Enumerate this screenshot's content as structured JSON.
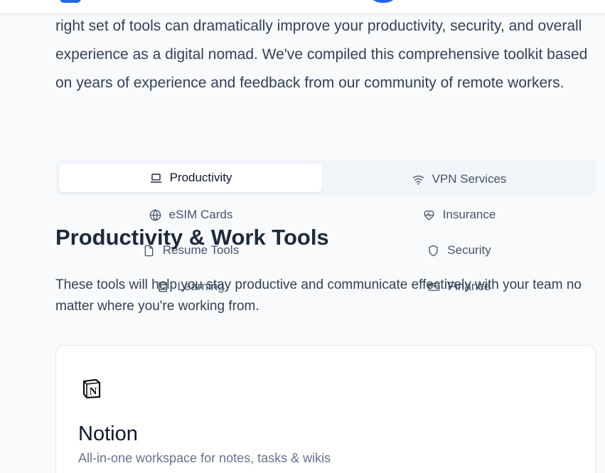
{
  "intro": {
    "text": "right set of tools can dramatically improve your productivity, security, and overall experience as a digital nomad. We've compiled this comprehensive toolkit based on years of experience and feedback from our community of remote workers."
  },
  "tabs": [
    {
      "label": "Productivity",
      "icon": "laptop-icon",
      "active": true
    },
    {
      "label": "VPN Services",
      "icon": "wifi-icon",
      "active": false
    },
    {
      "label": "eSIM Cards",
      "icon": "globe-icon",
      "active": false
    },
    {
      "label": "Insurance",
      "icon": "heart-pulse-icon",
      "active": false
    },
    {
      "label": "Resume Tools",
      "icon": "file-icon",
      "active": false
    },
    {
      "label": "Security",
      "icon": "shield-icon",
      "active": false
    },
    {
      "label": "Learning",
      "icon": "book-icon",
      "active": false
    },
    {
      "label": "Finance",
      "icon": "credit-card-icon",
      "active": false
    }
  ],
  "section": {
    "title": "Productivity & Work Tools",
    "description": "These tools will help you stay productive and communicate effectively with your team no matter where you're working from."
  },
  "card": {
    "icon": "notion-logo",
    "title": "Notion",
    "description": "All-in-one workspace for notes, tasks & wikis"
  },
  "colors": {
    "accent": "#2563eb",
    "background": "#f8fafc",
    "tab_bar": "#f1f5f9",
    "text": "#1e293b",
    "muted": "#64748b"
  }
}
